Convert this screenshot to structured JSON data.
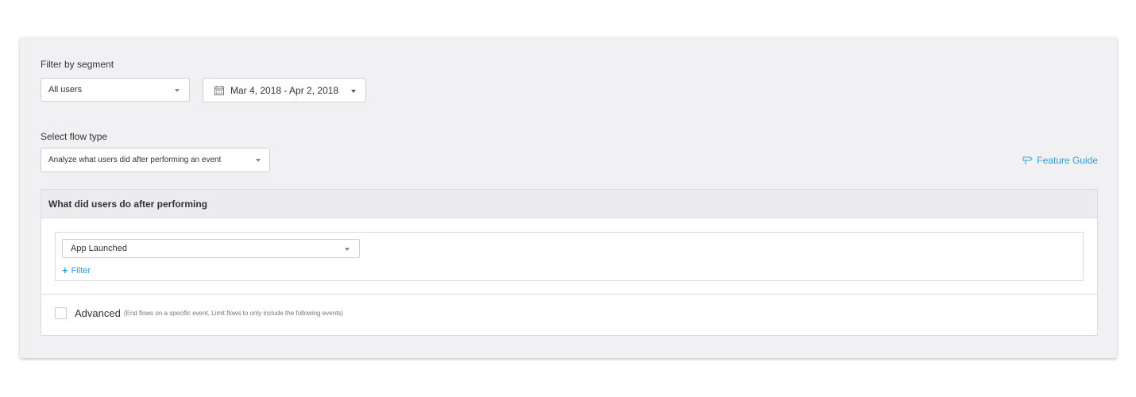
{
  "segment_filter": {
    "label": "Filter by segment",
    "segment_value": "All users",
    "date_range": "Mar 4, 2018 - Apr 2, 2018"
  },
  "flow_type": {
    "label": "Select flow type",
    "value": "Analyze what users did after performing an event"
  },
  "feature_guide": {
    "label": "Feature Guide"
  },
  "performing_section": {
    "title": "What did users do after performing",
    "event_value": "App Launched",
    "add_filter_label": "Filter",
    "add_filter_symbol": "+"
  },
  "advanced": {
    "label": "Advanced",
    "hint": "(End flows on a specific event, Limit flows to only include the following events)",
    "checked": false
  },
  "colors": {
    "panel_bg": "#f1f1f3",
    "link_blue": "#2a9fd8",
    "border": "#cfcfd3"
  }
}
